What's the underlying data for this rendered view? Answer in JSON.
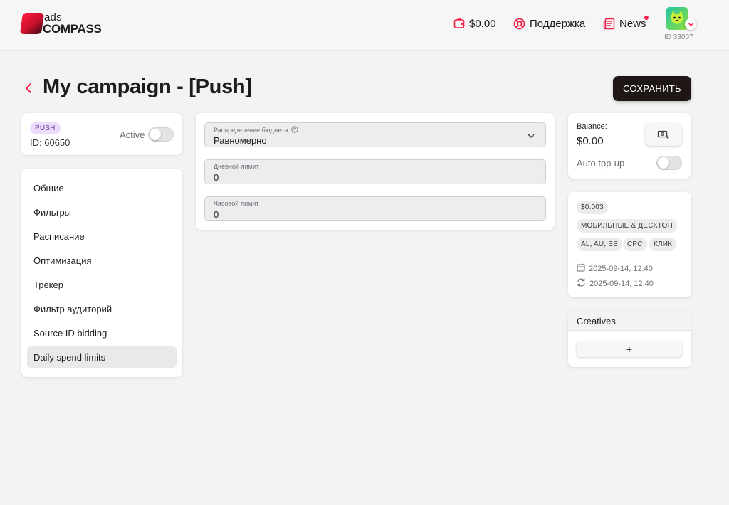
{
  "brand": {
    "ads": "ads",
    "compass": "COMPASS"
  },
  "header": {
    "balance": "$0.00",
    "support": "Поддержка",
    "news": "News",
    "user_id": "ID 33007"
  },
  "page": {
    "title": "My campaign - [Push]",
    "save_label": "СОХРАНИТЬ"
  },
  "campaign": {
    "type_badge": "PUSH",
    "id_text": "ID: 60650",
    "active_label": "Active",
    "active": false
  },
  "nav": {
    "items": [
      {
        "label": "Общие"
      },
      {
        "label": "Фильтры"
      },
      {
        "label": "Расписание"
      },
      {
        "label": "Оптимизация"
      },
      {
        "label": "Трекер"
      },
      {
        "label": "Фильтр аудиторий"
      },
      {
        "label": "Source ID bidding"
      },
      {
        "label": "Daily spend limits"
      }
    ],
    "selected": "Daily spend limits"
  },
  "form": {
    "budget_distribution": {
      "label": "Распределение бюджета",
      "value": "Равномерно"
    },
    "daily_limit": {
      "label": "Дневной лимит",
      "value": "0"
    },
    "hourly_limit": {
      "label": "Часовой лимит",
      "value": "0"
    }
  },
  "balance_card": {
    "label": "Balance:",
    "value": "$0.00",
    "auto_topup_label": "Auto top-up",
    "auto_topup": false
  },
  "summary": {
    "price": "$0.003",
    "device": "МОБИЛЬНЫЕ & ДЕСКТОП",
    "geo": "AL, AU, BB",
    "model": "CPC",
    "event": "КЛИК",
    "created": "2025-09-14, 12:40",
    "updated": "2025-09-14, 12:40"
  },
  "creatives": {
    "title": "Creatives",
    "add_label": "+"
  },
  "colors": {
    "accent": "#ef1f47",
    "dark_button": "#1f1616",
    "push_badge_bg": "#ecdcfb",
    "push_badge_text": "#6d3a9c"
  }
}
